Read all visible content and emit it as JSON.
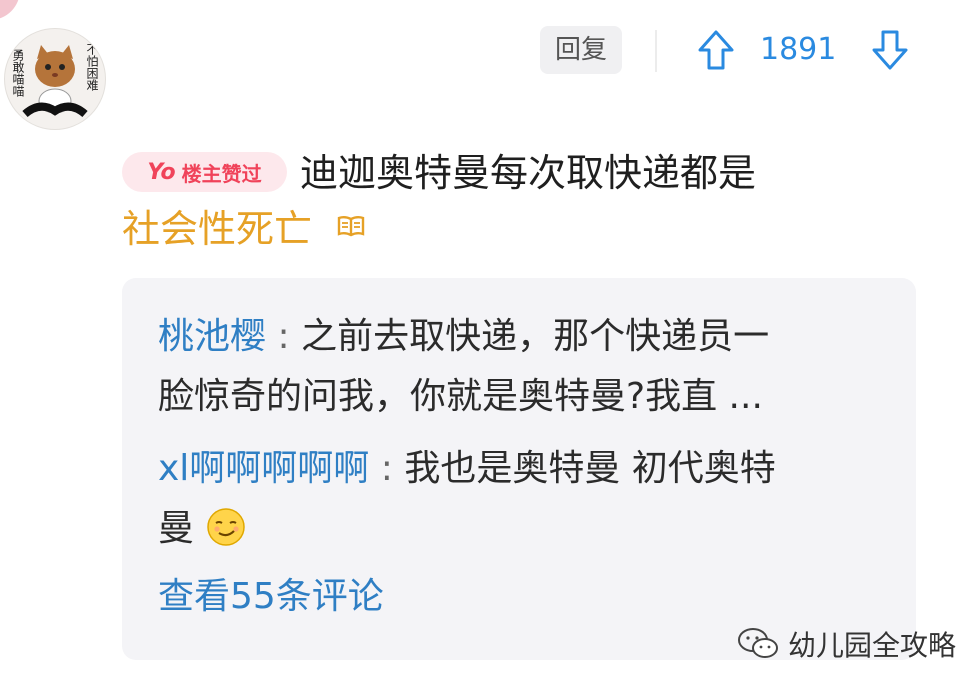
{
  "comment": {
    "avatar_text_left": "勇敢喵喵",
    "avatar_text_right": "不怕困难",
    "reply_label": "回复",
    "votes": "1891",
    "op_badge_prefix": "Yo",
    "op_badge_label": "楼主赞过",
    "text_line1": "迪迦奥特曼每次取快递都是",
    "text_line2": "社会性死亡"
  },
  "replies": [
    {
      "user": "桃池樱",
      "sep": ":",
      "text_line1": "之前去取快递，那个快递员一",
      "text_line2": "脸惊奇的问我，你就是奥特曼?我直 ..."
    },
    {
      "user": "xl啊啊啊啊啊",
      "sep": ":",
      "text_line1": "我也是奥特曼 初代奥特",
      "text_line2": "曼"
    }
  ],
  "view_more": "查看55条评论",
  "watermark": "幼儿园全攻略",
  "colors": {
    "accent_blue": "#2a8ae0",
    "badge_red": "#f0435a",
    "highlight_orange": "#e6a126"
  }
}
